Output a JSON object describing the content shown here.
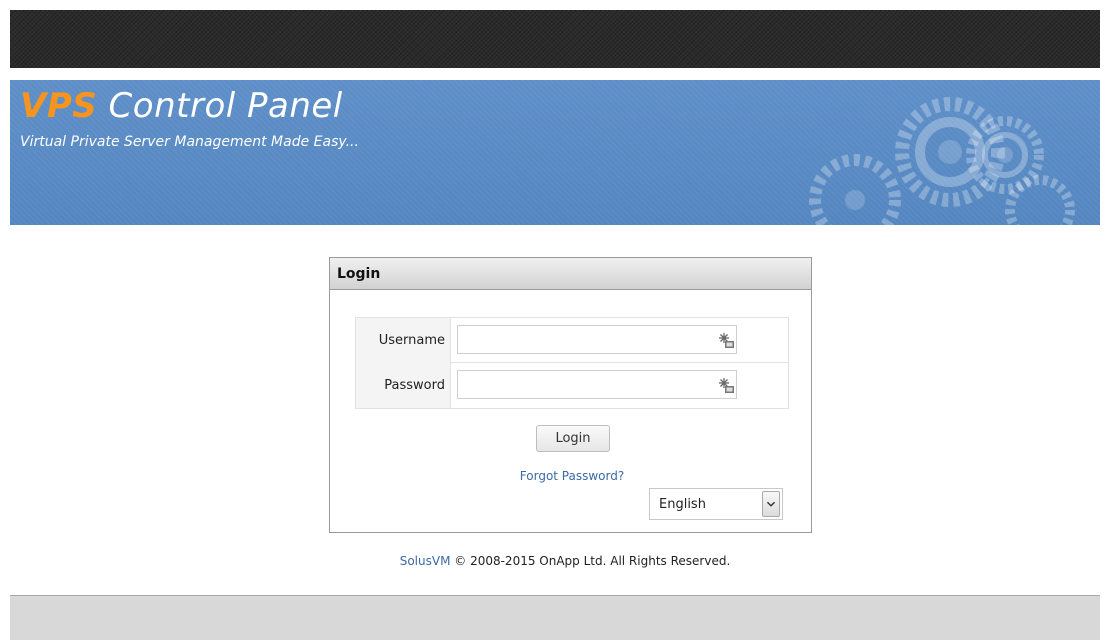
{
  "header": {
    "brand_prefix": "VPS",
    "brand_rest": " Control Panel",
    "tagline": "Virtual Private Server Management Made Easy..."
  },
  "login": {
    "heading": "Login",
    "username_label": "Username",
    "username_value": "",
    "password_label": "Password",
    "password_value": "",
    "submit_label": "Login",
    "forgot_link": "Forgot Password?",
    "language_selected": "English"
  },
  "footer": {
    "product_link": "SolusVM",
    "copyright": " © 2008-2015 OnApp Ltd. All Rights Reserved."
  },
  "colors": {
    "brand_accent": "#f7941d",
    "banner_blue": "#5b8cc5",
    "link_blue": "#3a6aa7"
  },
  "icons": {
    "field_icon": "password-manager-key-icon",
    "banner_art": "gears-icon",
    "select_arrow": "chevron-down-icon"
  }
}
